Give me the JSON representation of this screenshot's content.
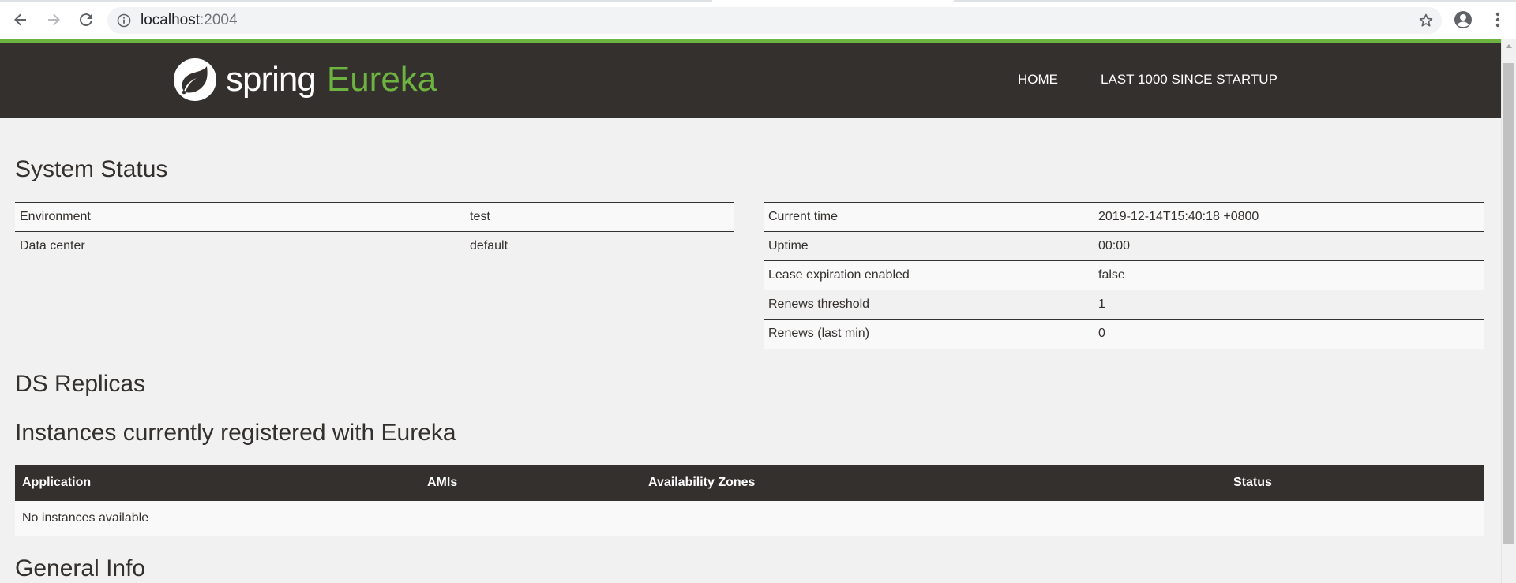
{
  "browser": {
    "url_host": "localhost",
    "url_port": ":2004"
  },
  "header": {
    "logo_spring": "spring",
    "logo_eureka": "Eureka",
    "nav": [
      "HOME",
      "LAST 1000 SINCE STARTUP"
    ]
  },
  "system_status": {
    "title": "System Status",
    "left": [
      {
        "key": "Environment",
        "value": "test"
      },
      {
        "key": "Data center",
        "value": "default"
      }
    ],
    "right": [
      {
        "key": "Current time",
        "value": "2019-12-14T15:40:18 +0800"
      },
      {
        "key": "Uptime",
        "value": "00:00"
      },
      {
        "key": "Lease expiration enabled",
        "value": "false"
      },
      {
        "key": "Renews threshold",
        "value": "1"
      },
      {
        "key": "Renews (last min)",
        "value": "0"
      }
    ]
  },
  "ds_replicas": {
    "title": "DS Replicas"
  },
  "instances": {
    "title": "Instances currently registered with Eureka",
    "columns": [
      "Application",
      "AMIs",
      "Availability Zones",
      "Status"
    ],
    "empty_text": "No instances available"
  },
  "general_info": {
    "title": "General Info"
  },
  "colors": {
    "brand_green": "#6db33f",
    "header_dark": "#34302d",
    "page_bg": "#f1f1f1"
  },
  "icons": [
    "back-icon",
    "forward-icon",
    "reload-icon",
    "info-icon",
    "star-icon",
    "account-icon",
    "menu-icon",
    "spring-leaf-icon"
  ]
}
